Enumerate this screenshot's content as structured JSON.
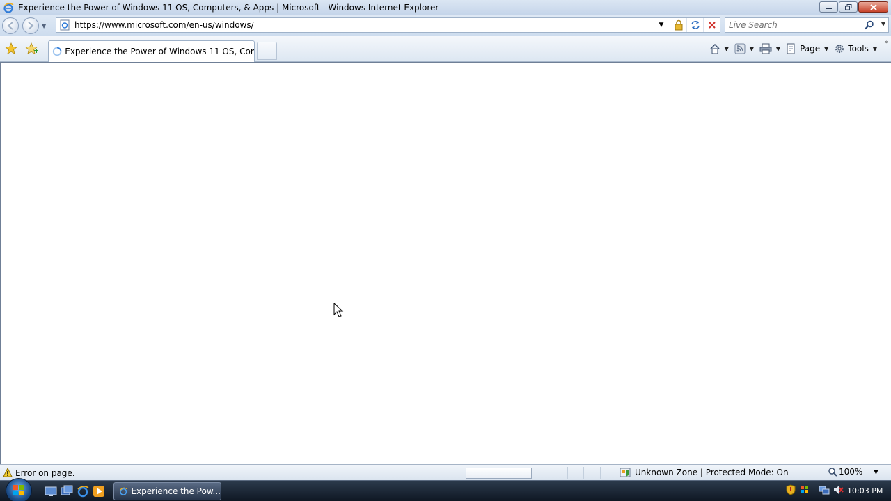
{
  "window": {
    "title": "Experience the Power of Windows 11 OS, Computers, & Apps | Microsoft - Windows Internet Explorer",
    "controls": [
      "minimize",
      "restore",
      "close"
    ]
  },
  "address": {
    "url": "https://www.microsoft.com/en-us/windows/",
    "search_placeholder": "Live Search"
  },
  "tabs": {
    "active_label": "Experience the Power of Windows 11 OS, Compu..."
  },
  "commandbar": {
    "page_label": "Page",
    "tools_label": "Tools"
  },
  "status": {
    "message": "Error on page.",
    "zone": "Unknown Zone | Protected Mode: On",
    "zoom": "100%",
    "progress_fraction": 0.0
  },
  "taskbar": {
    "window_button": "Experience the Pow...",
    "clock": "10:03 PM"
  },
  "colors": {
    "titlebar": "#c5d5ea",
    "taskbar": "#1a2433",
    "close_button": "#c8442c",
    "stop_icon": "#d0302a"
  }
}
